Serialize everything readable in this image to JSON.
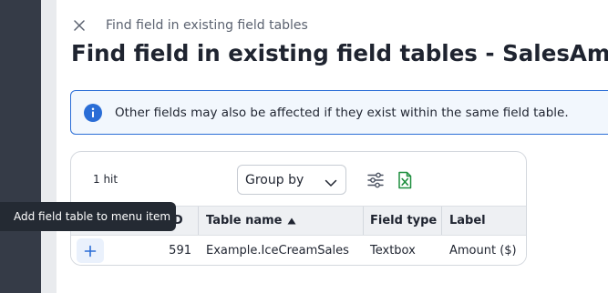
{
  "panel": {
    "breadcrumb": "Find field in existing field tables",
    "title": "Find field in existing field tables - SalesAmount",
    "banner_text": "Other fields may also be affected if they exist within the same field table."
  },
  "toolbar": {
    "hits": "1 hit",
    "group_by_label": "Group by"
  },
  "table": {
    "columns": [
      "ID",
      "Table name",
      "Field type",
      "Label"
    ],
    "sort_column": "Table name",
    "sort_direction": "ascending",
    "rows": [
      {
        "id": "591",
        "table_name": "Example.IceCreamSales",
        "field_type": "Textbox",
        "label": "Amount ($)"
      }
    ]
  },
  "tooltip": {
    "text": "Add field table to menu item"
  },
  "icons": {
    "close": "close-icon",
    "info": "info-icon",
    "chevron": "chevron-down-icon",
    "settings": "sliders-icon",
    "excel": "excel-export-icon",
    "add": "plus-icon",
    "sort": "sort-ascending-icon"
  },
  "colors": {
    "accent": "#2a6dd6",
    "excel_green": "#1e8e3e",
    "left_rail": "#353b47",
    "tooltip_bg": "#242a33"
  }
}
